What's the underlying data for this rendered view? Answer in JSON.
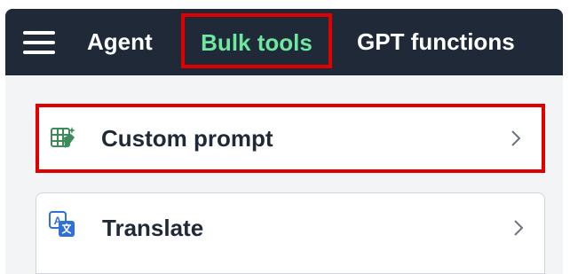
{
  "nav": {
    "menu_icon": "hamburger-menu-icon",
    "tabs": [
      {
        "label": "Agent"
      },
      {
        "label": "Bulk tools",
        "active": true
      },
      {
        "label": "GPT functions"
      }
    ]
  },
  "items": [
    {
      "label": "Custom prompt",
      "icon": "table-sparkle-icon"
    },
    {
      "label": "Translate",
      "icon": "translate-icon"
    }
  ],
  "colors": {
    "nav_bg": "#1f2937",
    "active_tab_text": "#6ee7a0",
    "highlight_border": "#e00000",
    "icon_green": "#3d8a5a",
    "icon_blue": "#2f6fd6"
  }
}
